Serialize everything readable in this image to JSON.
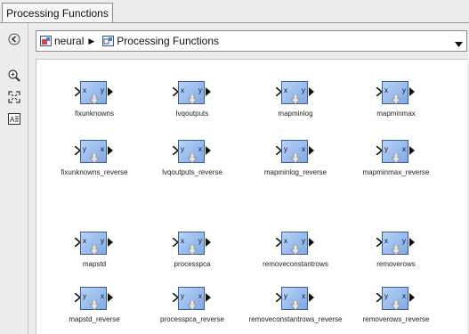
{
  "tab": {
    "label": "Processing Functions"
  },
  "address": {
    "root": "neural",
    "current": "Processing Functions"
  },
  "blocks": [
    {
      "name": "fixunknowns",
      "in": "x",
      "out": "y"
    },
    {
      "name": "lvqoutputs",
      "in": "x",
      "out": "y"
    },
    {
      "name": "mapminlog",
      "in": "x",
      "out": "y"
    },
    {
      "name": "mapminmax",
      "in": "x",
      "out": "y"
    },
    {
      "name": "fixunknowns_reverse",
      "in": "y",
      "out": "x"
    },
    {
      "name": "lvqoutputs_reverse",
      "in": "y",
      "out": "x"
    },
    {
      "name": "mapminlog_reverse",
      "in": "y",
      "out": "x"
    },
    {
      "name": "mapminmax_reverse",
      "in": "y",
      "out": "x"
    },
    {
      "name": "mapstd",
      "in": "x",
      "out": "y"
    },
    {
      "name": "processpca",
      "in": "x",
      "out": "y"
    },
    {
      "name": "removeconstantrows",
      "in": "x",
      "out": "y"
    },
    {
      "name": "removerows",
      "in": "x",
      "out": "y"
    },
    {
      "name": "mapstd_reverse",
      "in": "y",
      "out": "x"
    },
    {
      "name": "processpca_reverse",
      "in": "y",
      "out": "x"
    },
    {
      "name": "removeconstantrows_reverse",
      "in": "y",
      "out": "x"
    },
    {
      "name": "removerows_reverse",
      "in": "y",
      "out": "x"
    }
  ],
  "icons": {
    "back": "back-arrow-icon",
    "zoom": "zoom-in-icon",
    "fit": "fit-to-view-icon",
    "annotation": "annotation-icon",
    "dropdown": "chevron-down-icon"
  },
  "colors": {
    "block_fill": "#8fb5ea",
    "block_border": "#3d5d8e"
  }
}
